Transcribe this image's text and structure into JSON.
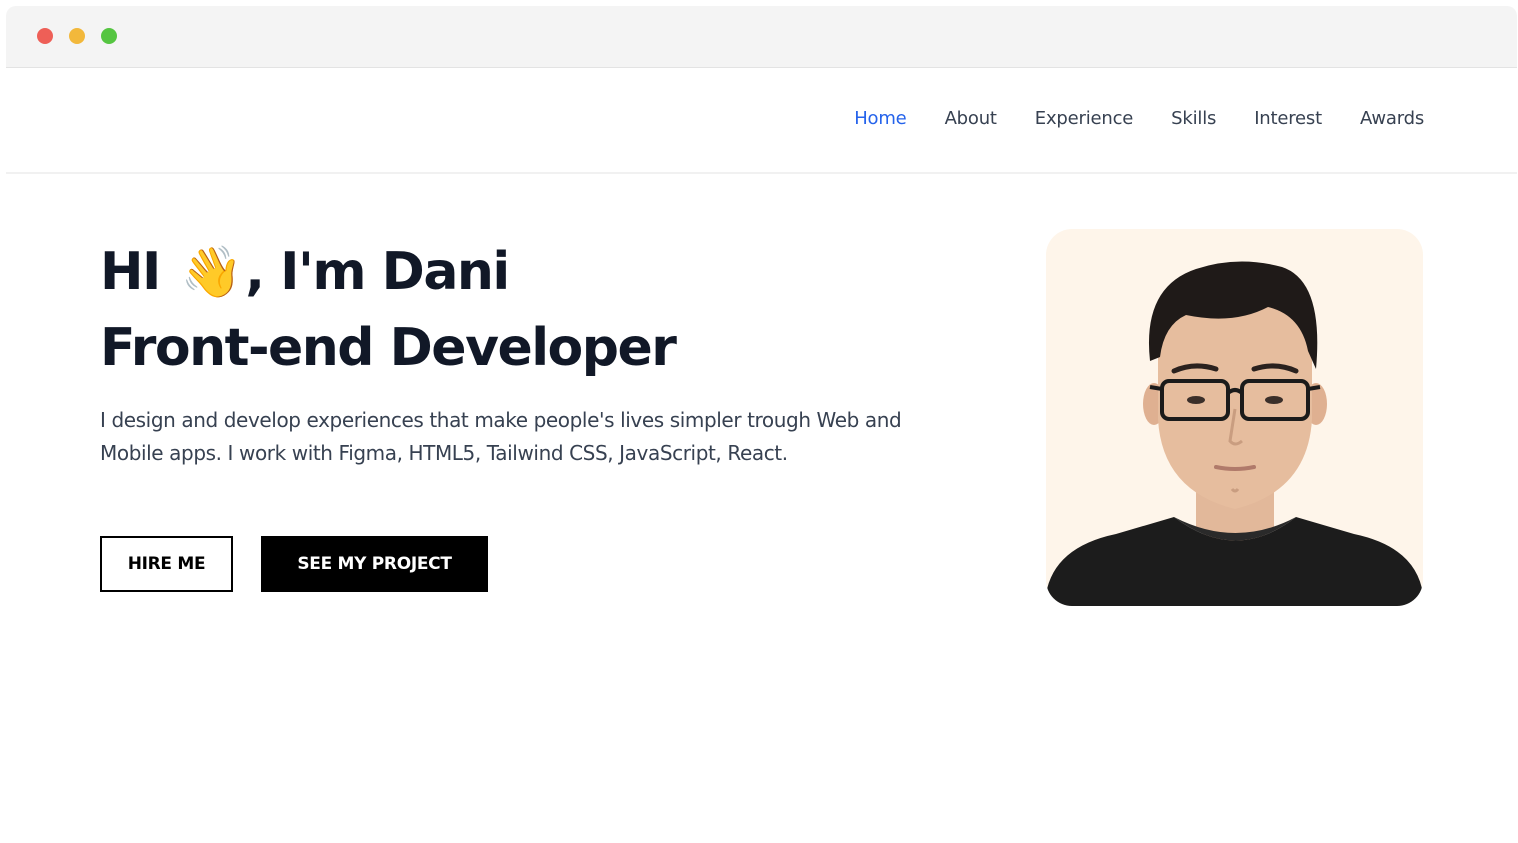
{
  "window": {
    "controls": {
      "close_color": "#ee5f57",
      "minimize_color": "#f2b83b",
      "maximize_color": "#55c541"
    }
  },
  "nav": {
    "items": [
      {
        "label": "Home",
        "active": true
      },
      {
        "label": "About",
        "active": false
      },
      {
        "label": "Experience",
        "active": false
      },
      {
        "label": "Skills",
        "active": false
      },
      {
        "label": "Interest",
        "active": false
      },
      {
        "label": "Awards",
        "active": false
      }
    ],
    "active_color": "#2563eb"
  },
  "hero": {
    "greeting_prefix": "HI",
    "wave_emoji": "👋",
    "greeting_suffix": ", I'm Dani",
    "role": "Front-end Developer",
    "description": "I design and develop experiences that make people's lives simpler trough Web and Mobile apps. I work with Figma, HTML5, Tailwind CSS, JavaScript, React.",
    "hire_button": "HIRE ME",
    "project_button": "SEE MY PROJECT"
  },
  "portrait": {
    "icon": "person-portrait",
    "background_color": "#fef5ea"
  }
}
